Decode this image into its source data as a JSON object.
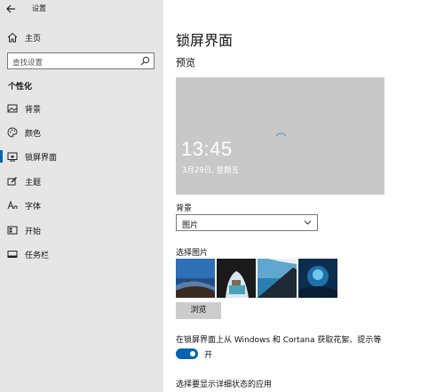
{
  "window": {
    "title": "设置"
  },
  "sidebar": {
    "home_label": "主页",
    "search_placeholder": "查找设置",
    "section_title": "个性化",
    "items": [
      {
        "label": "背景",
        "icon": "picture-icon"
      },
      {
        "label": "颜色",
        "icon": "palette-icon"
      },
      {
        "label": "锁屏界面",
        "icon": "lock-screen-icon",
        "active": true
      },
      {
        "label": "主题",
        "icon": "theme-brush-icon"
      },
      {
        "label": "字体",
        "icon": "font-icon"
      },
      {
        "label": "开始",
        "icon": "start-grid-icon"
      },
      {
        "label": "任务栏",
        "icon": "taskbar-icon"
      }
    ]
  },
  "main": {
    "page_title": "锁屏界面",
    "preview_label": "预览",
    "preview_time": "13:45",
    "preview_date": "3月29日, 星期五",
    "background_label": "背景",
    "background_value": "图片",
    "choose_picture_label": "选择图片",
    "browse_label": "浏览",
    "fun_facts_label": "在锁屏界面上从 Windows 和 Cortana 获取花絮、提示等",
    "toggle_state": "开",
    "toggle_on": true,
    "detailed_status_label": "选择要显示详细状态的应用"
  },
  "colors": {
    "accent": "#0063b1",
    "sidebar_bg": "#e6e6e6",
    "preview_bg": "#c8c8c8"
  }
}
